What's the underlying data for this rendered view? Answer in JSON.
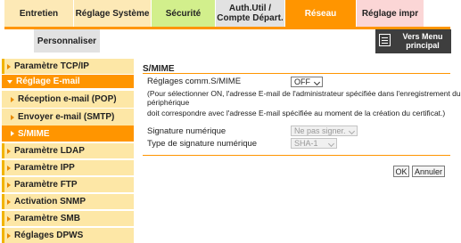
{
  "tabs": {
    "entretien": "Entretien",
    "systeme": "Réglage Système",
    "securite": "Sécurité",
    "auth_line1": "Auth.Util /",
    "auth_line2": "Compte Départ.",
    "reseau": "Réseau",
    "impr": "Réglage impr",
    "personnaliser": "Personnaliser"
  },
  "vers_menu": {
    "line1": "Vers Menu",
    "line2": "principal"
  },
  "sidebar": [
    {
      "label": "Paramètre TCP/IP"
    },
    {
      "label": "Réglage E-mail"
    },
    {
      "label": "Réception e-mail (POP)"
    },
    {
      "label": "Envoyer e-mail (SMTP)"
    },
    {
      "label": "S/MIME"
    },
    {
      "label": "Paramètre LDAP"
    },
    {
      "label": "Paramètre IPP"
    },
    {
      "label": "Paramètre FTP"
    },
    {
      "label": "Activation SNMP"
    },
    {
      "label": "Paramètre SMB"
    },
    {
      "label": "Réglages DPWS"
    }
  ],
  "main": {
    "title": "S/MIME",
    "comm_label": "Réglages comm.S/MIME",
    "comm_value": "OFF",
    "note_line1": "(Pour sélectionner ON, l'adresse E-mail de l'administrateur spécifiée dans l'enregistrement du",
    "note_line2": "périphérique",
    "note_line3": "doit correspondre avec l'adresse E-mail spécifiée au moment de la création du certificat.)",
    "sig_label": "Signature numérique",
    "sig_value": "Ne pas signer.",
    "sigtype_label": "Type de signature numérique",
    "sigtype_value": "SHA-1"
  },
  "buttons": {
    "ok": "OK",
    "cancel": "Annuler"
  }
}
